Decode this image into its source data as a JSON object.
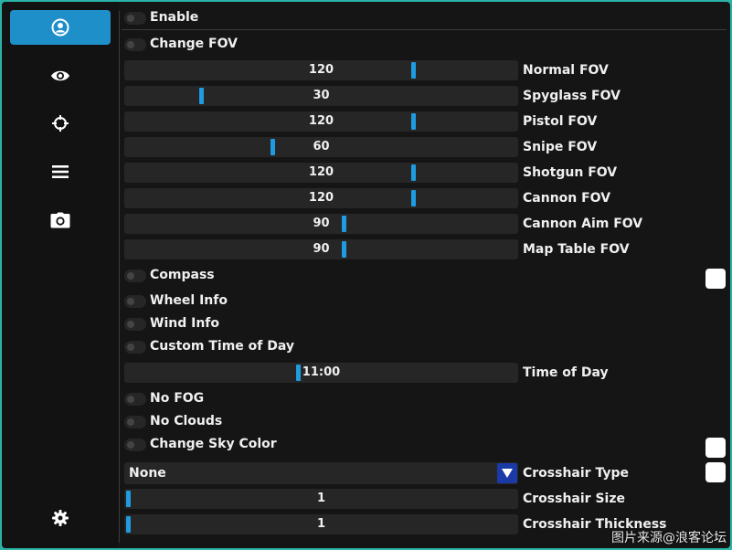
{
  "sidebar": {
    "items": [
      {
        "icon": "user-icon",
        "active": true
      },
      {
        "icon": "eye-icon",
        "active": false
      },
      {
        "icon": "crosshair-icon",
        "active": false
      },
      {
        "icon": "menu-icon",
        "active": false
      },
      {
        "icon": "camera-icon",
        "active": false
      }
    ],
    "settings_icon": "gear-icon"
  },
  "toggles": {
    "enable": {
      "label": "Enable",
      "on": false
    },
    "change_fov": {
      "label": "Change FOV",
      "on": false
    },
    "compass": {
      "label": "Compass",
      "on": false
    },
    "wheel_info": {
      "label": "Wheel Info",
      "on": false
    },
    "wind_info": {
      "label": "Wind Info",
      "on": false
    },
    "custom_time": {
      "label": "Custom Time of Day",
      "on": false
    },
    "no_fog": {
      "label": "No FOG",
      "on": false
    },
    "no_clouds": {
      "label": "No Clouds",
      "on": false
    },
    "change_sky_color": {
      "label": "Change Sky Color",
      "on": false
    }
  },
  "fov_sliders": [
    {
      "label": "Normal FOV",
      "value": "120",
      "fraction": 0.74
    },
    {
      "label": "Spyglass FOV",
      "value": "30",
      "fraction": 0.19
    },
    {
      "label": "Pistol FOV",
      "value": "120",
      "fraction": 0.74
    },
    {
      "label": "Snipe FOV",
      "value": "60",
      "fraction": 0.375
    },
    {
      "label": "Shotgun FOV",
      "value": "120",
      "fraction": 0.74
    },
    {
      "label": "Cannon FOV",
      "value": "120",
      "fraction": 0.74
    },
    {
      "label": "Cannon Aim FOV",
      "value": "90",
      "fraction": 0.56
    },
    {
      "label": "Map Table FOV",
      "value": "90",
      "fraction": 0.56
    }
  ],
  "time_of_day": {
    "label": "Time of Day",
    "value": "11:00",
    "fraction": 0.44
  },
  "crosshair": {
    "type_label": "Crosshair Type",
    "type_value": "None",
    "size": {
      "label": "Crosshair Size",
      "value": "1",
      "fraction": 0.0
    },
    "thickness": {
      "label": "Crosshair Thickness",
      "value": "1",
      "fraction": 0.0
    }
  },
  "colors": {
    "accent": "#1f9be0",
    "active_tab": "#1f8fca",
    "dropdown_arrow": "#1a3aa8",
    "swatch": "#ffffff"
  },
  "watermark": "图片来源@浪客论坛"
}
